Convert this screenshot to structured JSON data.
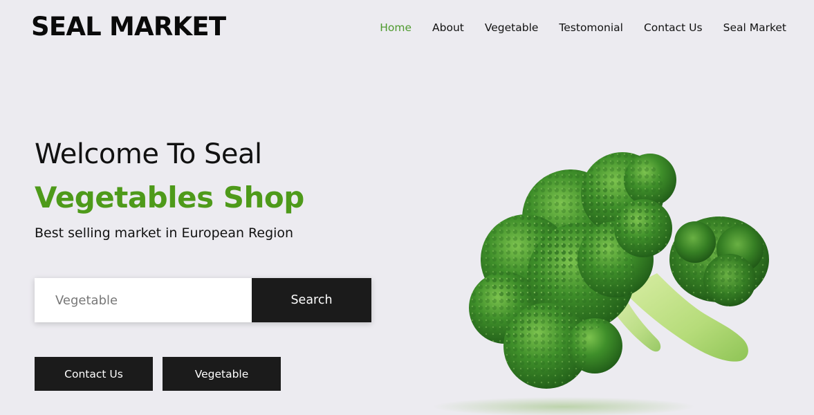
{
  "header": {
    "brand": "SEAL MARKET",
    "nav": [
      {
        "label": "Home",
        "active": true
      },
      {
        "label": "About",
        "active": false
      },
      {
        "label": "Vegetable",
        "active": false
      },
      {
        "label": "Testomonial",
        "active": false
      },
      {
        "label": "Contact Us",
        "active": false
      },
      {
        "label": "Seal Market",
        "active": false
      }
    ]
  },
  "hero": {
    "title": "Welcome To Seal",
    "subtitle": "Vegetables Shop",
    "tagline": "Best selling market in European Region",
    "search": {
      "placeholder": "Vegetable",
      "value": "",
      "button_label": "Search"
    },
    "buttons": {
      "contact_label": "Contact Us",
      "vegetable_label": "Vegetable"
    },
    "image": "broccoli"
  },
  "colors": {
    "background": "#ecebf0",
    "accent_green": "#4e9a1a",
    "button_dark": "#1b1b1b"
  }
}
